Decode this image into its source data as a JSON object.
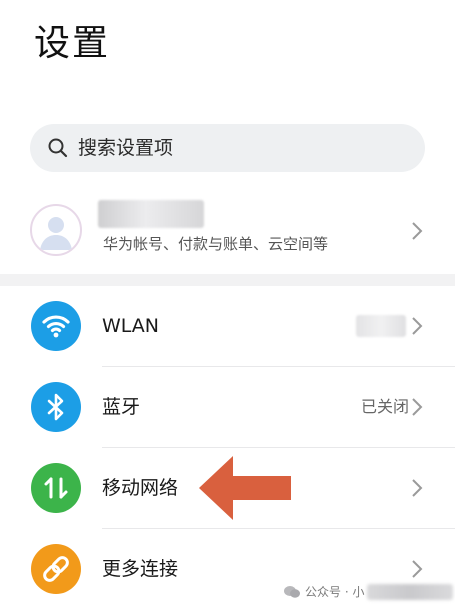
{
  "page": {
    "title": "设置"
  },
  "search": {
    "placeholder": "搜索设置项",
    "icon": "search-icon"
  },
  "account": {
    "subtitle": "华为帐号、付款与账单、云空间等",
    "icon": "avatar-icon"
  },
  "settings": [
    {
      "label": "WLAN",
      "value": "",
      "icon": "wifi-icon",
      "color": "#1c9ee6"
    },
    {
      "label": "蓝牙",
      "value": "已关闭",
      "icon": "bluetooth-icon",
      "color": "#1c9ee6"
    },
    {
      "label": "移动网络",
      "value": "",
      "icon": "mobile-data-icon",
      "color": "#3cb44a"
    },
    {
      "label": "更多连接",
      "value": "",
      "icon": "link-icon",
      "color": "#f29a1a"
    }
  ],
  "annotation": {
    "icon": "arrow-left-icon",
    "color": "#d9603e"
  },
  "watermark": {
    "text": "公众号 · 小"
  },
  "colors": {
    "accent_blue": "#1c9ee6",
    "accent_green": "#3cb44a",
    "accent_orange": "#f29a1a",
    "arrow": "#d9603e"
  }
}
